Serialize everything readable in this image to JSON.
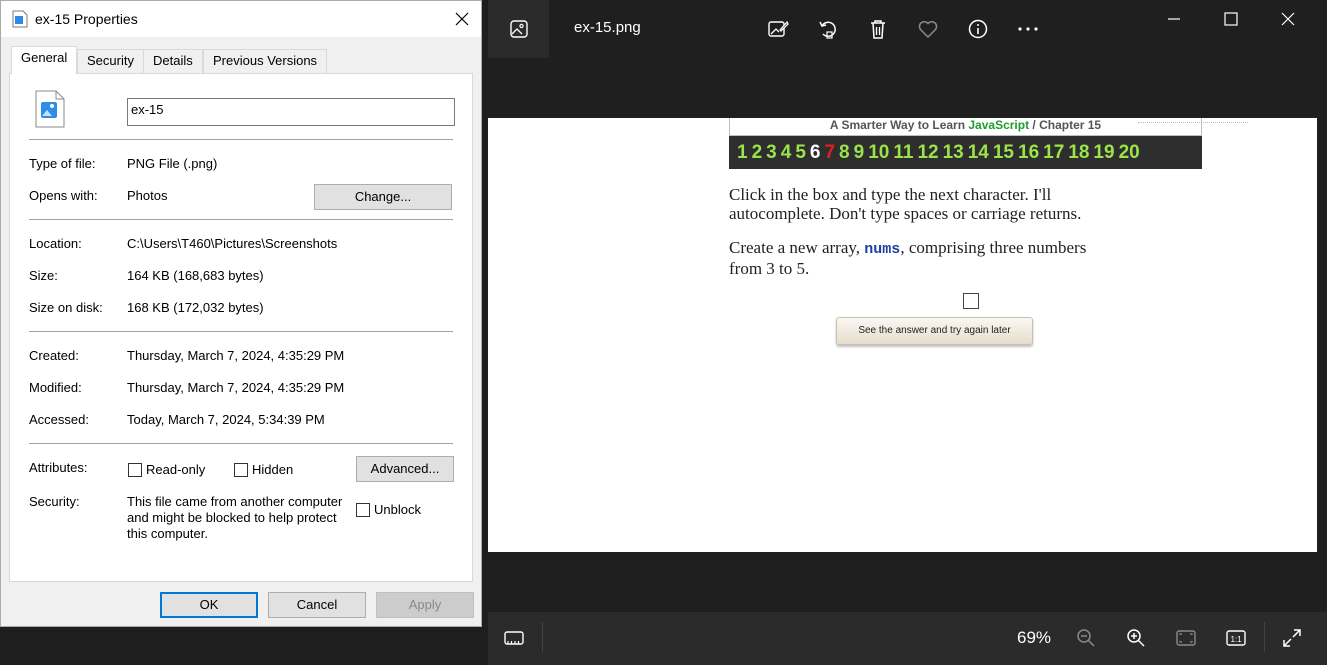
{
  "dialog": {
    "title": "ex-15 Properties",
    "tabs": [
      {
        "label": "General",
        "active": true
      },
      {
        "label": "Security"
      },
      {
        "label": "Details"
      },
      {
        "label": "Previous Versions"
      }
    ],
    "file_name": "ex-15",
    "fields": {
      "type_label": "Type of file:",
      "type_value": "PNG File (.png)",
      "opens_label": "Opens with:",
      "opens_value": "Photos",
      "change_button": "Change...",
      "location_label": "Location:",
      "location_value": "C:\\Users\\T460\\Pictures\\Screenshots",
      "size_label": "Size:",
      "size_value": "164 KB (168,683 bytes)",
      "disk_label": "Size on disk:",
      "disk_value": "168 KB (172,032 bytes)",
      "created_label": "Created:",
      "created_value": "Thursday, March 7, 2024, 4:35:29 PM",
      "modified_label": "Modified:",
      "modified_value": "Thursday, March 7, 2024, 4:35:29 PM",
      "accessed_label": "Accessed:",
      "accessed_value": "Today, March 7, 2024, 5:34:39 PM",
      "attributes_label": "Attributes:",
      "readonly_label": "Read-only",
      "hidden_label": "Hidden",
      "advanced_button": "Advanced...",
      "security_label": "Security:",
      "security_text": "This file came from another computer and might be blocked to help protect this computer.",
      "unblock_label": "Unblock"
    },
    "buttons": {
      "ok": "OK",
      "cancel": "Cancel",
      "apply": "Apply"
    }
  },
  "photos": {
    "file_title": "ex-15.png",
    "zoom": "69%",
    "toolbar_icons": [
      "edit-image-icon",
      "rotate-icon",
      "delete-icon",
      "favorite-icon",
      "info-icon",
      "more-icon"
    ],
    "bottom_icons": [
      "filmstrip-icon",
      "zoom-out-icon",
      "zoom-in-icon",
      "fit-icon",
      "actual-size-icon",
      "fullscreen-icon"
    ],
    "image": {
      "header_prefix": "A Smarter Way to Learn ",
      "header_brand": "JavaScript",
      "header_suffix": " / Chapter 15",
      "chapters": [
        "1",
        "2",
        "3",
        "4",
        "5",
        "6",
        "7",
        "8",
        "9",
        "10",
        "11",
        "12",
        "13",
        "14",
        "15",
        "16",
        "17",
        "18",
        "19",
        "20"
      ],
      "current_chapter": "6",
      "red_chapter": "7",
      "instruction_1": "Click in the box and type the next character. I'll",
      "instruction_2": "autocomplete. Don't type spaces or carriage returns.",
      "task_prefix": "Create a new array, ",
      "task_code": "nums",
      "task_suffix": ", comprising three numbers",
      "task_line2": "from 3 to 5.",
      "answer_button": "See the answer and try again later"
    }
  }
}
